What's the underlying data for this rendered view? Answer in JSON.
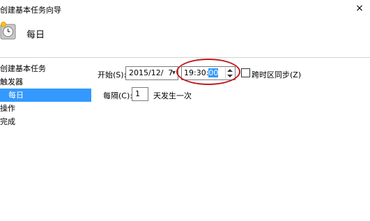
{
  "window": {
    "title": "创建基本任务向导",
    "close_glyph": "×"
  },
  "header": {
    "title": "每日",
    "icon": "clock-icon"
  },
  "nav": {
    "items": [
      {
        "label": "创建基本任务",
        "selected": false
      },
      {
        "label": "触发器",
        "selected": false
      },
      {
        "label": "每日",
        "selected": true
      },
      {
        "label": "操作",
        "selected": false
      },
      {
        "label": "完成",
        "selected": false
      }
    ]
  },
  "form": {
    "start_label": "开始(S):",
    "start_date": "2015/12/  7",
    "start_time_prefix": "19:30:",
    "start_time_selected": "00",
    "sync_tz_label": "跨时区同步(Z)",
    "sync_tz_checked": false,
    "interval_label": "每隔(C):",
    "interval_value": "1",
    "interval_suffix": "天发生一次"
  },
  "colors": {
    "selection": "#3399ff",
    "annotation_circle": "#c0181b"
  }
}
